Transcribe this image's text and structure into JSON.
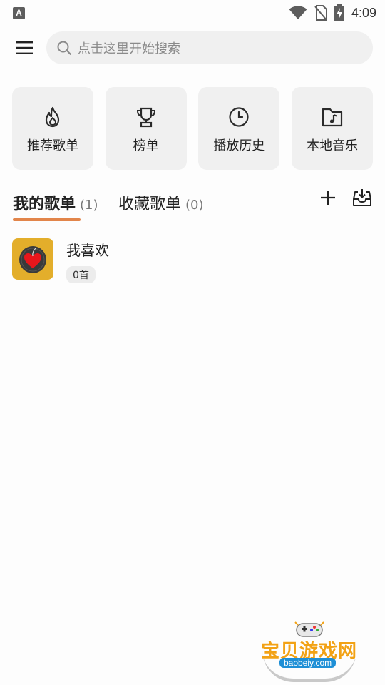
{
  "status_bar": {
    "notification_badge": "A",
    "time": "4:09"
  },
  "search": {
    "placeholder": "点击这里开始搜索"
  },
  "quick_access": [
    {
      "label": "推荐歌单",
      "icon": "flame-icon"
    },
    {
      "label": "榜单",
      "icon": "trophy-icon"
    },
    {
      "label": "播放历史",
      "icon": "clock-icon"
    },
    {
      "label": "本地音乐",
      "icon": "music-folder-icon"
    }
  ],
  "tabs": {
    "my_playlists": {
      "label": "我的歌单",
      "count": "(1)"
    },
    "collected_playlists": {
      "label": "收藏歌单",
      "count": "(0)"
    }
  },
  "playlists": [
    {
      "name": "我喜欢",
      "count": "0首"
    }
  ],
  "watermark": {
    "title": "宝贝游戏网",
    "url": "baobeiy.com"
  },
  "colors": {
    "accent": "#e2854a",
    "card_bg": "#f0f0f0",
    "cover_bg": "#e3ae2b"
  }
}
